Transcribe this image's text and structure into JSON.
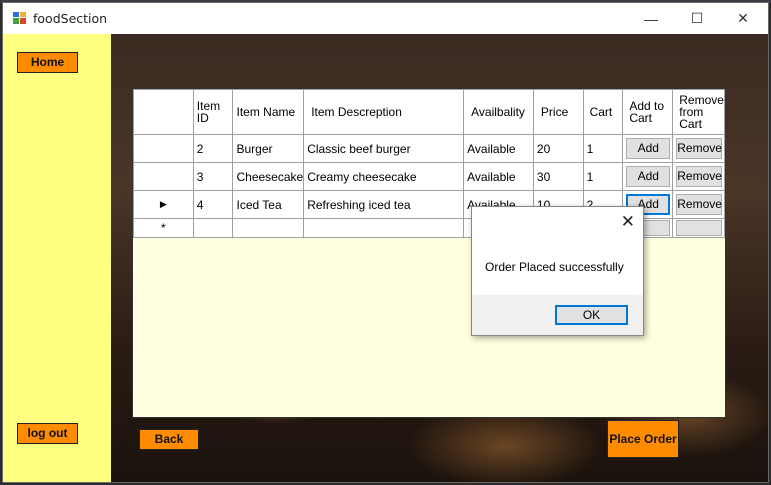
{
  "window": {
    "title": "foodSection",
    "minimize_glyph": "—",
    "maximize_glyph": "☐",
    "close_glyph": "✕"
  },
  "sidebar": {
    "home_label": "Home",
    "logout_label": "log out"
  },
  "actions": {
    "back_label": "Back",
    "place_order_label": "Place Order"
  },
  "grid": {
    "columns": [
      "Item ID",
      "Item Name",
      "Item Descreption",
      "Availbality",
      "Price",
      "Cart",
      "Add to Cart",
      "Remove from Cart"
    ],
    "rows": [
      {
        "indicator": "",
        "id": "2",
        "name": "Burger",
        "description": "Classic beef burger",
        "availability": "Available",
        "price": "20",
        "cart": "1",
        "add": "Add",
        "remove": "Remove"
      },
      {
        "indicator": "",
        "id": "3",
        "name": "Cheesecake",
        "description": "Creamy cheesecake",
        "availability": "Available",
        "price": "30",
        "cart": "1",
        "add": "Add",
        "remove": "Remove"
      },
      {
        "indicator": "▶",
        "id": "4",
        "name": "Iced Tea",
        "description": "Refreshing iced tea",
        "availability": "Available",
        "price": "10",
        "cart": "2",
        "add": "Add",
        "remove": "Remove"
      }
    ],
    "new_row_indicator": "*"
  },
  "dialog": {
    "message": "Order Placed successfully",
    "ok_label": "OK",
    "close_glyph": "✕"
  },
  "colors": {
    "sidebar": "#ffff80",
    "button_orange": "#ff8c00",
    "grid_background": "#ffffe0",
    "focus_blue": "#0078d7"
  }
}
